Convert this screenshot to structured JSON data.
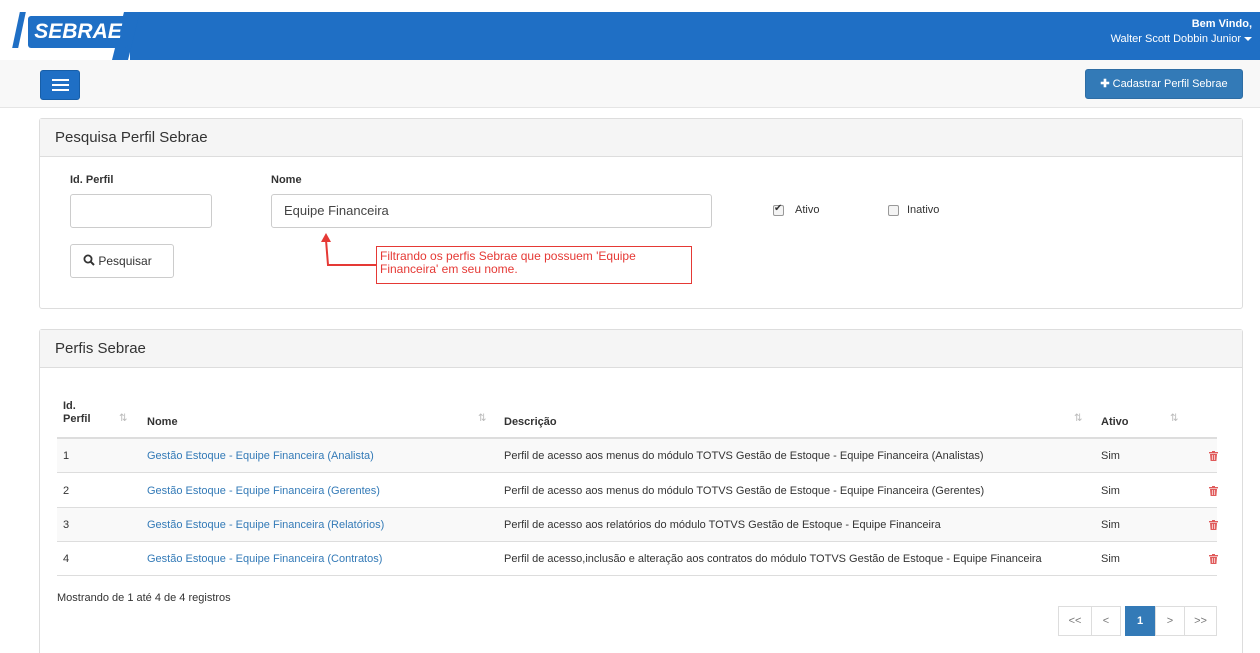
{
  "header": {
    "logo_text": "SEBRAE",
    "welcome_label": "Bem Vindo,",
    "user_name": "Walter Scott Dobbin Junior"
  },
  "toolbar": {
    "register_label": "Cadastrar Perfil Sebrae"
  },
  "search_panel": {
    "title": "Pesquisa Perfil Sebrae",
    "id_label": "Id. Perfil",
    "id_value": "",
    "name_label": "Nome",
    "name_value": "Equipe Financeira",
    "active_label": "Ativo",
    "active_checked": true,
    "inactive_label": "Inativo",
    "inactive_checked": false,
    "search_label": "Pesquisar",
    "annotation": "Filtrando os perfis Sebrae que possuem 'Equipe Financeira' em seu nome."
  },
  "results_panel": {
    "title": "Perfis Sebrae",
    "columns": {
      "id_line1": "Id.",
      "id_line2": "Perfil",
      "name": "Nome",
      "description": "Descrição",
      "active": "Ativo"
    },
    "rows": [
      {
        "id": "1",
        "name": "Gestão Estoque - Equipe Financeira (Analista)",
        "description": "Perfil de acesso aos menus do módulo TOTVS Gestão de Estoque - Equipe Financeira (Analistas)",
        "active": "Sim"
      },
      {
        "id": "2",
        "name": "Gestão Estoque - Equipe Financeira (Gerentes)",
        "description": "Perfil de acesso aos menus do módulo TOTVS Gestão de Estoque - Equipe Financeira (Gerentes)",
        "active": "Sim"
      },
      {
        "id": "3",
        "name": "Gestão Estoque - Equipe Financeira (Relatórios)",
        "description": "Perfil de acesso aos relatórios do módulo TOTVS Gestão de Estoque - Equipe Financeira",
        "active": "Sim"
      },
      {
        "id": "4",
        "name": "Gestão Estoque - Equipe Financeira (Contratos)",
        "description": "Perfil de acesso,inclusão e alteração aos contratos do módulo TOTVS Gestão de Estoque - Equipe Financeira",
        "active": "Sim"
      }
    ],
    "summary": "Mostrando de 1 até 4 de 4 registros",
    "pagination": {
      "first": "<<",
      "prev": "<",
      "current": "1",
      "next": ">",
      "last": ">>"
    }
  },
  "colors": {
    "brand_blue": "#1f6fc5",
    "primary": "#337ab7",
    "annotation_red": "#e53935",
    "delete_red": "#e05a5a"
  }
}
